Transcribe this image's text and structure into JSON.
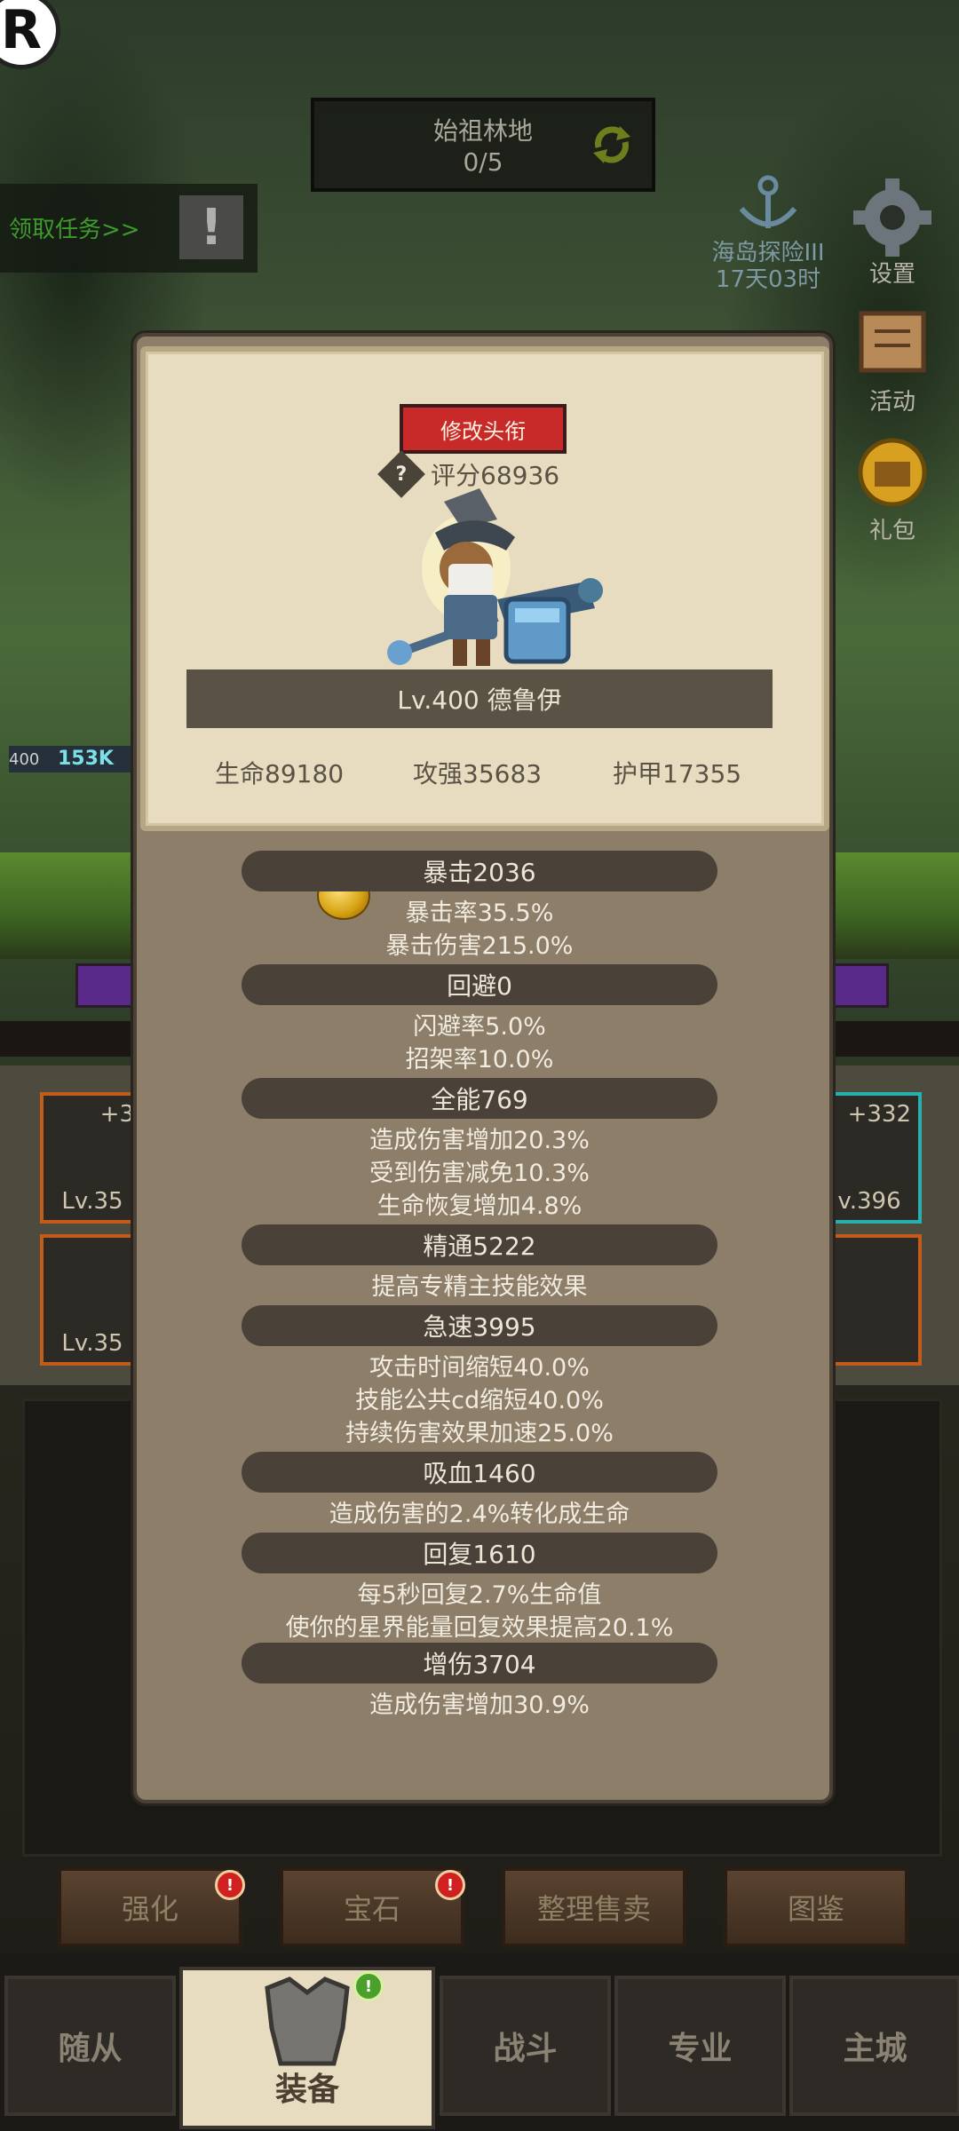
{
  "location": {
    "name": "始祖林地",
    "progress": "0/5"
  },
  "quest": {
    "label": "领取任务>>",
    "alert": "!"
  },
  "logo_letter": "R",
  "event": {
    "title": "海岛探险III",
    "timer": "17天03时"
  },
  "side_menu": {
    "settings": "设置",
    "activity": "活动",
    "gift": "礼包"
  },
  "player_hp": {
    "level": "400",
    "value": "153K"
  },
  "card": {
    "rename_button": "修改头衔",
    "score_icon": "?",
    "score": "评分68936",
    "name": "Lv.400 德鲁伊",
    "hp": "生命89180",
    "attack": "攻强35683",
    "armor": "护甲17355"
  },
  "stats": [
    {
      "header": "暴击2036",
      "lines": [
        "暴击率35.5%",
        "暴击伤害215.0%"
      ]
    },
    {
      "header": "回避0",
      "lines": [
        "闪避率5.0%",
        "招架率10.0%"
      ]
    },
    {
      "header": "全能769",
      "lines": [
        "造成伤害增加20.3%",
        "受到伤害减免10.3%",
        "生命恢复增加4.8%"
      ]
    },
    {
      "header": "精通5222",
      "lines": [
        "提高专精主技能效果"
      ]
    },
    {
      "header": "急速3995",
      "lines": [
        "攻击时间缩短40.0%",
        "技能公共cd缩短40.0%",
        "持续伤害效果加速25.0%"
      ]
    },
    {
      "header": "吸血1460",
      "lines": [
        "造成伤害的2.4%转化成生命"
      ]
    },
    {
      "header": "回复1610",
      "lines": [
        "每5秒回复2.7%生命值",
        "使你的星界能量回复效果提高20.1%"
      ]
    },
    {
      "header": "增伤3704",
      "lines": [
        "造成伤害增加30.9%"
      ]
    }
  ],
  "equip_slots": {
    "left_top": {
      "plus": "+3",
      "level": "Lv.35"
    },
    "left_bottom": {
      "level": "Lv.35"
    },
    "right_top": {
      "plus": "+332",
      "level": "v.396"
    }
  },
  "action_buttons": {
    "enhance": "强化",
    "gem": "宝石",
    "sort_sell": "整理售卖",
    "codex": "图鉴",
    "badge": "!"
  },
  "bottom_nav": {
    "followers": "随从",
    "equipment": "装备",
    "battle": "战斗",
    "profession": "专业",
    "city": "主城",
    "badge": "!"
  }
}
